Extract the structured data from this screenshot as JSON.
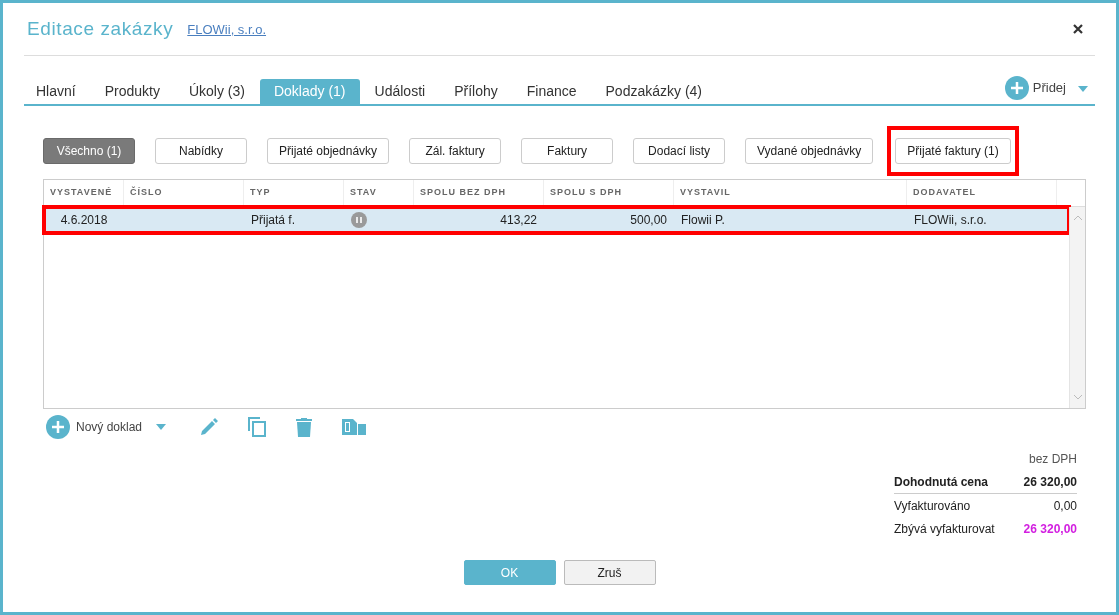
{
  "window": {
    "title": "Editace zakázky",
    "link": "FLOWii, s.r.o."
  },
  "tabs": [
    {
      "label": "Hlavní",
      "selected": false
    },
    {
      "label": "Produkty",
      "selected": false
    },
    {
      "label": "Úkoly (3)",
      "selected": false
    },
    {
      "label": "Doklady (1)",
      "selected": true
    },
    {
      "label": "Události",
      "selected": false
    },
    {
      "label": "Přílohy",
      "selected": false
    },
    {
      "label": "Finance",
      "selected": false
    },
    {
      "label": "Podzakázky (4)",
      "selected": false
    }
  ],
  "add_button": {
    "label": "Přidej"
  },
  "filters": [
    {
      "label": "Všechno (1)",
      "selected": true,
      "highlighted": false
    },
    {
      "label": "Nabídky",
      "selected": false,
      "highlighted": false
    },
    {
      "label": "Přijaté objednávky",
      "selected": false,
      "highlighted": false
    },
    {
      "label": "Zál. faktury",
      "selected": false,
      "highlighted": false
    },
    {
      "label": "Faktury",
      "selected": false,
      "highlighted": false
    },
    {
      "label": "Dodací listy",
      "selected": false,
      "highlighted": false
    },
    {
      "label": "Vydané objednávky",
      "selected": false,
      "highlighted": false
    },
    {
      "label": "Přijaté faktury (1)",
      "selected": false,
      "highlighted": true
    }
  ],
  "table": {
    "columns": [
      "VYSTAVENÉ",
      "ČÍSLO",
      "TYP",
      "STAV",
      "SPOLU BEZ DPH",
      "SPOLU S DPH",
      "VYSTAVIL",
      "DODAVATEL"
    ],
    "rows": [
      {
        "selected": true,
        "highlighted": true,
        "cells": [
          "4.6.2018",
          "",
          "Přijatá f.",
          "",
          "413,22",
          "500,00",
          "Flowii P.",
          "FLOWii, s.r.o."
        ]
      }
    ]
  },
  "toolbar": {
    "new_label": "Nový doklad"
  },
  "summary": {
    "header": "bez DPH",
    "rows": [
      {
        "label": "Dohodnutá cena",
        "value": "26 320,00",
        "kind": "total"
      },
      {
        "label": "Vyfakturováno",
        "value": "0,00",
        "kind": "normal"
      },
      {
        "label": "Zbývá vyfakturovat",
        "value": "26 320,00",
        "kind": "remaining"
      }
    ]
  },
  "buttons": [
    {
      "label": "OK",
      "kind": "primary"
    },
    {
      "label": "Zruš",
      "kind": "secondary"
    }
  ]
}
